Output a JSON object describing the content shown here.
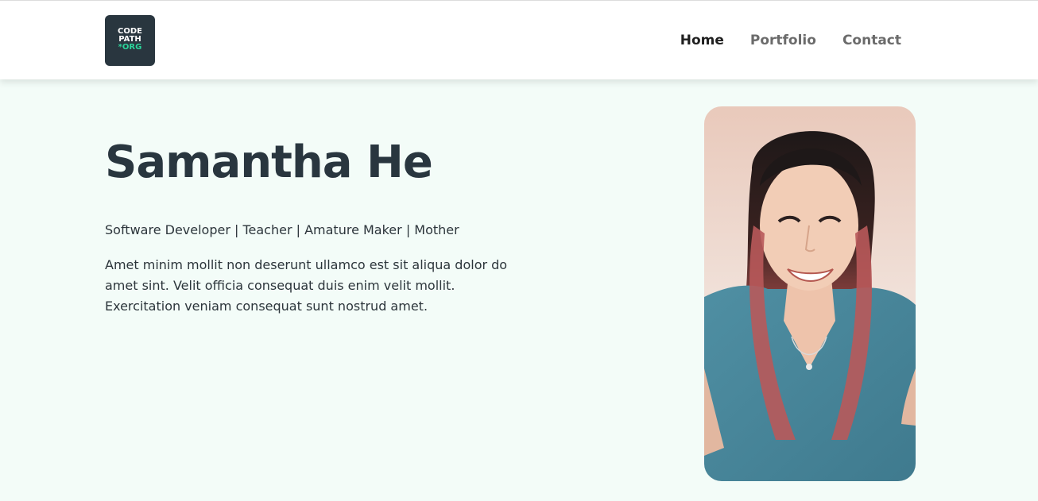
{
  "header": {
    "logo": {
      "line1": "CODE",
      "line2": "PATH",
      "line3": "*ORG"
    },
    "nav": [
      {
        "label": "Home",
        "active": true
      },
      {
        "label": "Portfolio",
        "active": false
      },
      {
        "label": "Contact",
        "active": false
      }
    ]
  },
  "hero": {
    "name": "Samantha He",
    "tagline": "Software Developer | Teacher | Amature Maker | Mother",
    "bio": "Amet minim mollit non deserunt ullamco est sit aliqua dolor do amet sint. Velit officia consequat duis enim velit mollit. Exercitation veniam consequat sunt nostrud amet."
  },
  "colors": {
    "background": "#f3fcf8",
    "text_dark": "#29363f",
    "logo_accent": "#2bd59a",
    "nav_inactive": "#6b6b6b"
  }
}
